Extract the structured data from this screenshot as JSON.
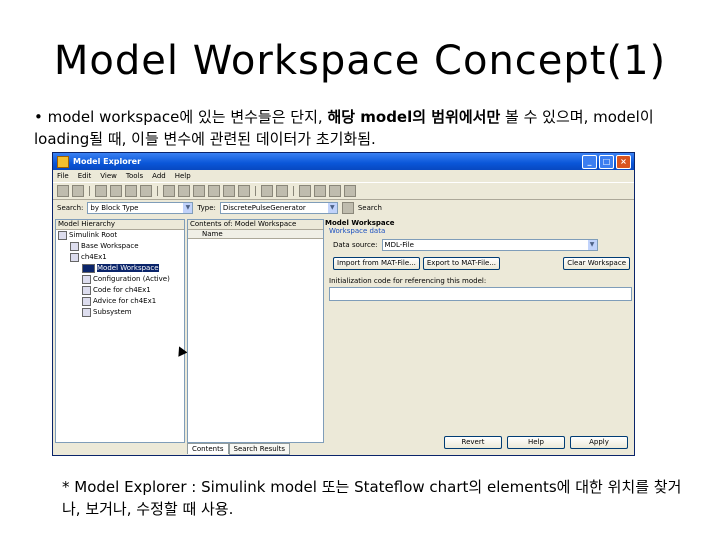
{
  "slide": {
    "title": "Model Workspace Concept(1)",
    "bullet_plain": "• model workspace에 있는 변수들은 단지, ",
    "bullet_bold": "해당 model의 범위에서만",
    "bullet_rest": " 볼 수 있으며, model이 loading될 때, 이들 변수에 관련된 데이터가 초기화됨.",
    "note": "* Model Explorer : Simulink model 또는 Stateflow chart의 elements에 대한 위치를 찾거나, 보거나, 수정할 때 사용."
  },
  "window": {
    "title": "Model Explorer",
    "menu": [
      "File",
      "Edit",
      "View",
      "Tools",
      "Add",
      "Help"
    ],
    "search_label": "Search:",
    "search_by": "by Block Type",
    "type_label": "Type:",
    "type_value": "DiscretePulseGenerator",
    "search_button": "Search",
    "hierarchy_header": "Model Hierarchy",
    "tree": [
      "Simulink Root",
      "Base Workspace",
      "ch4Ex1",
      "Model Workspace",
      "Configuration (Active)",
      "Code for ch4Ex1",
      "Advice for ch4Ex1",
      "Subsystem"
    ],
    "contents_header": "Contents of: Model Workspace",
    "contents_column": "Name",
    "tabs": [
      "Contents",
      "Search Results"
    ],
    "dialog_title": "Model Workspace",
    "workspace_data_label": "Workspace data",
    "data_source_label": "Data source:",
    "data_source_value": "MDL-File",
    "import_button": "Import from MAT-File...",
    "export_button": "Export to MAT-File...",
    "clear_button": "Clear Workspace",
    "init_label": "Initialization code for referencing this model:",
    "revert_button": "Revert",
    "help_button": "Help",
    "apply_button": "Apply"
  }
}
